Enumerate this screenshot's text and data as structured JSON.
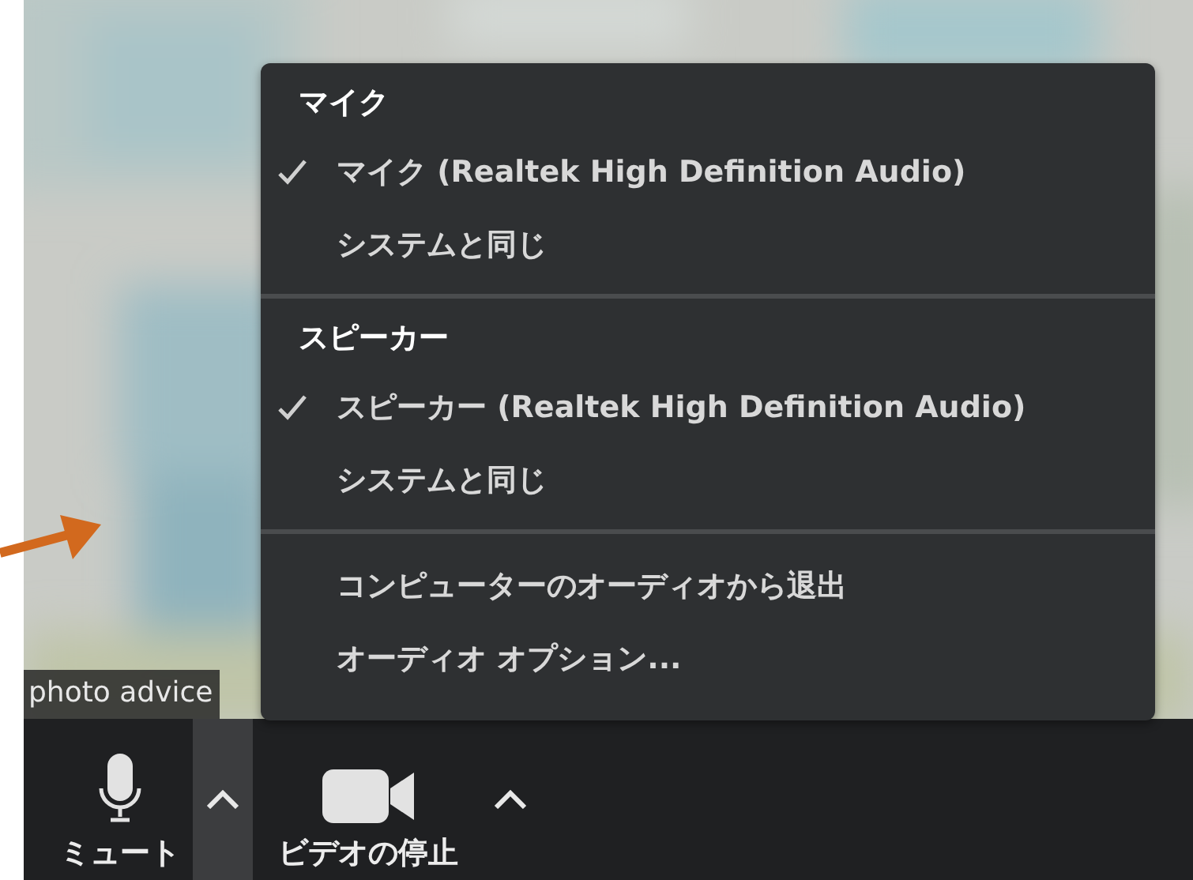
{
  "video": {
    "kind": "picture",
    "name_label": "photo advice"
  },
  "audio_menu": {
    "sections": [
      {
        "title": "マイク",
        "items": [
          {
            "label": "マイク (Realtek High Definition Audio)",
            "selected": true
          },
          {
            "label": "システムと同じ",
            "selected": false
          }
        ]
      },
      {
        "title": "スピーカー",
        "items": [
          {
            "label": "スピーカー (Realtek High Definition Audio)",
            "selected": true
          },
          {
            "label": "システムと同じ",
            "selected": false
          }
        ]
      },
      {
        "items": [
          {
            "label": "コンピューターのオーディオから退出"
          },
          {
            "label": "オーディオ オプション..."
          }
        ]
      }
    ]
  },
  "toolbar": [
    {
      "kind": "mute",
      "label": "ミュート"
    },
    {
      "kind": "caret",
      "expanded": true
    },
    {
      "kind": "video",
      "label": "ビデオの停止"
    },
    {
      "kind": "caret",
      "expanded": false
    }
  ]
}
